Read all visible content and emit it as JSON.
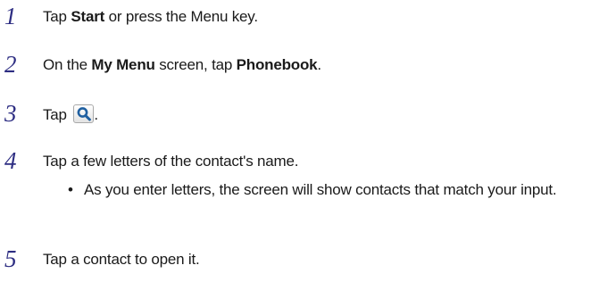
{
  "steps": [
    {
      "number": "1",
      "parts": [
        "Tap ",
        "Start",
        " or press the Menu key."
      ]
    },
    {
      "number": "2",
      "parts": [
        "On the ",
        "My Menu",
        " screen, tap ",
        "Phonebook",
        "."
      ]
    },
    {
      "number": "3",
      "parts": [
        "Tap ",
        "."
      ],
      "icon": "search-magnifier-icon"
    },
    {
      "number": "4",
      "parts": [
        "Tap a few letters of the contact's name."
      ],
      "bullet": {
        "marker": "•",
        "text": "As you enter letters, the screen will show contacts that match your input."
      }
    },
    {
      "number": "5",
      "parts": [
        "Tap a contact to open it."
      ]
    }
  ],
  "colors": {
    "step_number": "#2d2d82",
    "text": "#1a1a1a",
    "icon_glyph": "#1f5fa0"
  }
}
